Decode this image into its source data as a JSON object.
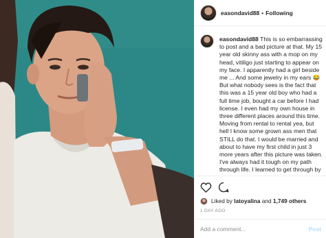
{
  "post": {
    "username": "easondavid88",
    "follow_separator": "•",
    "follow_label": "Following"
  },
  "caption": {
    "username": "easondavid88",
    "text": "This is so embarrassing to post and a bad picture at that. My 15 year old skinny ass with a mop on my head, vitiligo just starting to appear on my face. I apparently had a girl beside me ... And some jewelry in my ears 😂 But what nobody sees is the fact that this was a 15 year old boy who had a full time job, bought a car before I had license. I even had my own house in three different places around this time. Moving from rental to rental yea, but hell I know some grown ass men that STILL do that. I would be married and about to have my first child in just 3 more years after this picture was taken. I've always had it tough on my path through life. I learned to get through by focusing on the day I"
  },
  "likes": {
    "prefix": "Liked by",
    "user": "latoyalina",
    "connector": "and",
    "others": "1,749 others"
  },
  "timestamp": "1 DAY AGO",
  "comment": {
    "placeholder": "Add a comment...",
    "post_label": "Post"
  },
  "icons": {
    "like": "heart-icon",
    "comment": "comment-bubble-icon"
  },
  "colors": {
    "post_button": "#b2dffc",
    "muted": "#8e8e8e",
    "photo_background": "#2b8584"
  }
}
